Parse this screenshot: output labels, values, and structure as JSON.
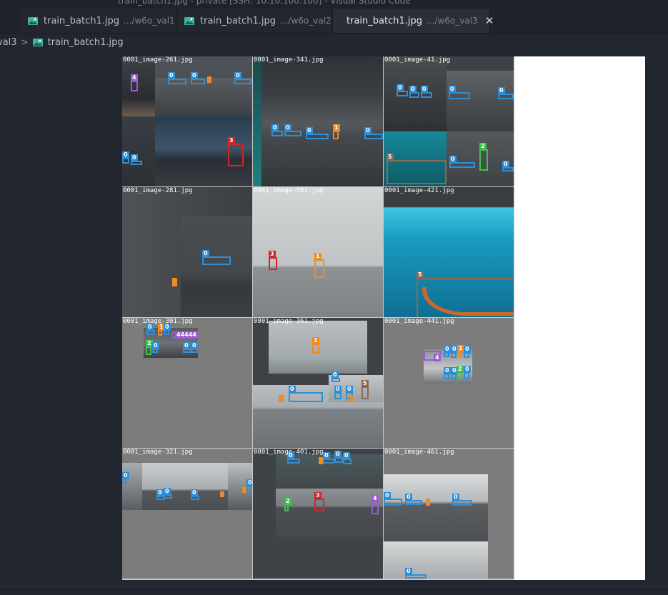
{
  "window": {
    "title": "train_batch1.jpg - private [SSH: 10.10.100.100] - Visual Studio Code"
  },
  "tabs": [
    {
      "name": "train_batch1.jpg",
      "dir": ".../w6o_val1",
      "active": false
    },
    {
      "name": "train_batch1.jpg",
      "dir": ".../w6o_val2",
      "active": false
    },
    {
      "name": "train_batch1.jpg",
      "dir": ".../w6o_val3",
      "active": true
    }
  ],
  "tab_close_glyph": "✕",
  "breadcrumb": {
    "folder": "val3",
    "separator": ">",
    "file": "train_batch1.jpg"
  },
  "icons": {
    "image_file": "image-file-icon",
    "close": "close-icon"
  },
  "colors": {
    "class0": "#2e8fd6",
    "class1": "#f08a24",
    "class2": "#3cc24a",
    "class3": "#d0262d",
    "class4": "#9a5cd6",
    "class5": "#8a6a55"
  },
  "mosaic": {
    "tiles": [
      {
        "label": "0001_image-261.jpg"
      },
      {
        "label": "0001_image-341.jpg"
      },
      {
        "label": "0001_image-41.jpg"
      },
      {
        "label": "0001_image-281.jpg"
      },
      {
        "label": "0001_image-381.jpg"
      },
      {
        "label": "0001_image-421.jpg"
      },
      {
        "label": "0001_image-301.jpg"
      },
      {
        "label": "0001_image-361.jpg"
      },
      {
        "label": "0001_image-441.jpg"
      },
      {
        "label": "0001_image-321.jpg"
      },
      {
        "label": "0001_image-401.jpg"
      },
      {
        "label": "0001_image-461.jpg"
      }
    ],
    "box_labels": {
      "c0": "0",
      "c1": "1",
      "c2": "2",
      "c3": "3",
      "c4": "4",
      "c5": "5",
      "c4x": "44444"
    }
  }
}
